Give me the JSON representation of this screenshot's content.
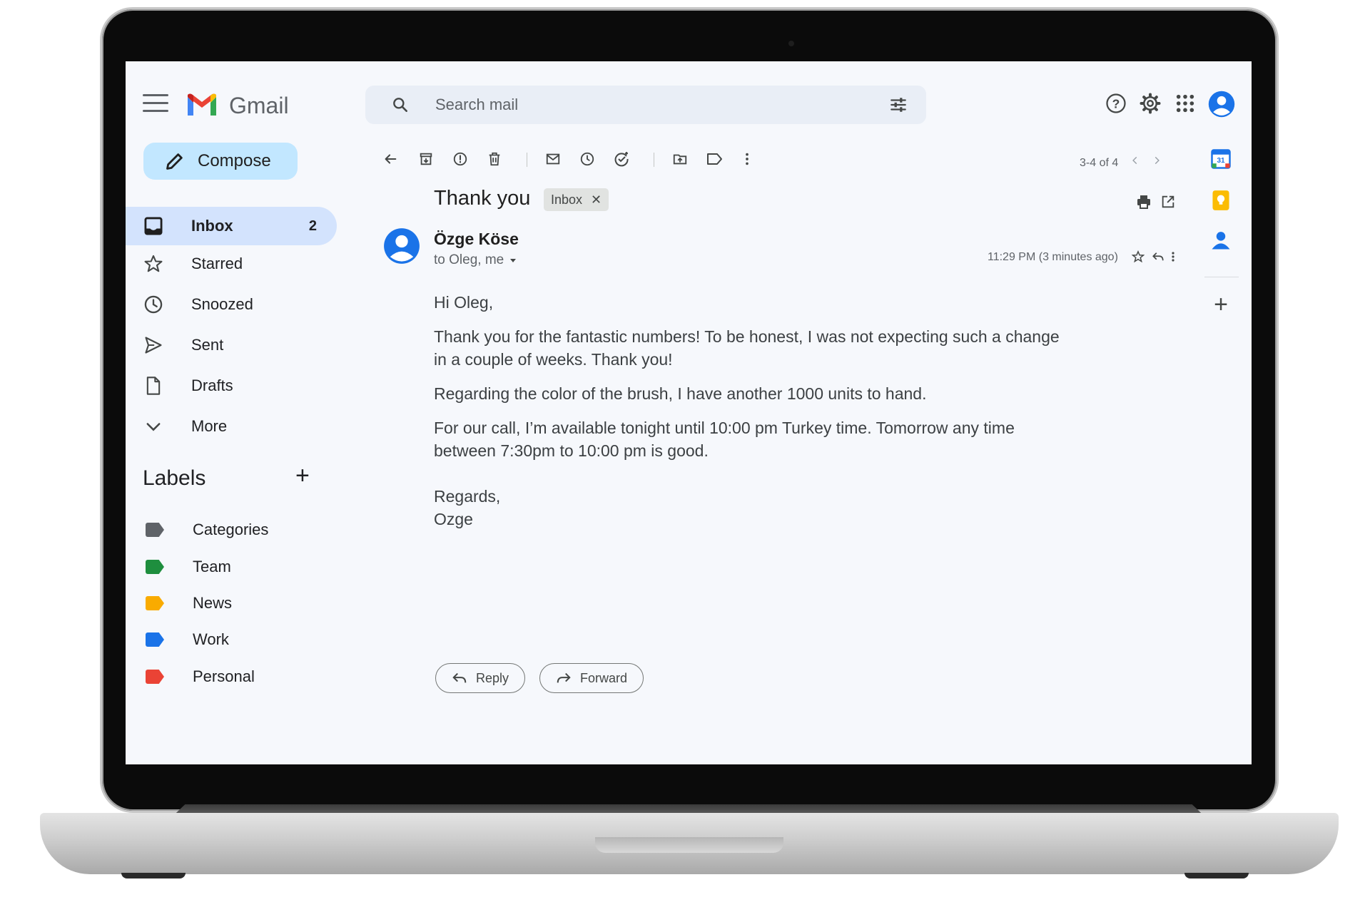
{
  "app": {
    "title": "Gmail"
  },
  "compose": {
    "label": "Compose"
  },
  "nav": {
    "items": [
      {
        "label": "Inbox",
        "count": "2"
      },
      {
        "label": "Starred"
      },
      {
        "label": "Snoozed"
      },
      {
        "label": "Sent"
      },
      {
        "label": "Drafts"
      },
      {
        "label": "More"
      }
    ]
  },
  "labels": {
    "title": "Labels",
    "items": [
      {
        "label": "Categories",
        "color": "#5f6368"
      },
      {
        "label": "Team",
        "color": "#1e8e3e"
      },
      {
        "label": "News",
        "color": "#f9ab00"
      },
      {
        "label": "Work",
        "color": "#1a73e8"
      },
      {
        "label": "Personal",
        "color": "#ea4335"
      }
    ]
  },
  "search": {
    "placeholder": "Search mail"
  },
  "pager": {
    "text": "3-4 of 4"
  },
  "email": {
    "subject": "Thank you",
    "chip": "Inbox",
    "sender": "Özge Köse",
    "recipients": "to Oleg, me",
    "timestamp": "11:29 PM (3 minutes ago)",
    "greeting": "Hi Oleg,",
    "p1_l1": "Thank you for the fantastic numbers! To be honest, I was not expecting such a change",
    "p1_l2": "in a couple of weeks. Thank you!",
    "p2": "Regarding the color of the brush, I have another 1000 units to hand.",
    "p3_l1": "For our call, I’m available tonight until 10:00 pm Turkey time. Tomorrow any time",
    "p3_l2": "between 7:30pm to 10:00 pm is good.",
    "closing": "Regards,",
    "signature": "Ozge"
  },
  "actions": {
    "reply": "Reply",
    "forward": "Forward"
  },
  "colors": {
    "accent": "#1a73e8",
    "compose_bg": "#c2e7ff",
    "active_nav": "#d3e3fd"
  }
}
